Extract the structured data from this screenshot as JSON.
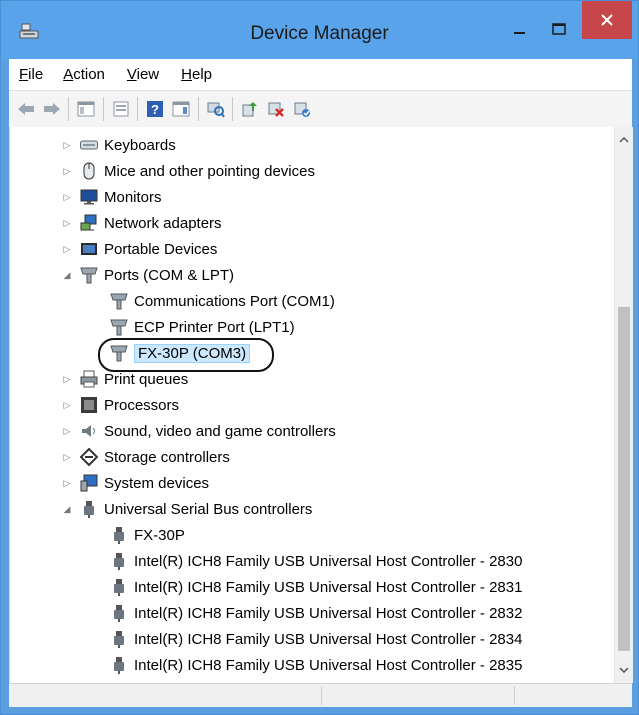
{
  "window": {
    "title": "Device Manager"
  },
  "menu": [
    {
      "prefix": "",
      "underlined": "F",
      "rest": "ile"
    },
    {
      "prefix": "",
      "underlined": "A",
      "rest": "ction"
    },
    {
      "prefix": "",
      "underlined": "V",
      "rest": "iew"
    },
    {
      "prefix": "",
      "underlined": "H",
      "rest": "elp"
    }
  ],
  "tree": {
    "keyboards": "Keyboards",
    "mice": "Mice and other pointing devices",
    "monitors": "Monitors",
    "network": "Network adapters",
    "portable": "Portable Devices",
    "ports": "Ports (COM & LPT)",
    "com1": "Communications Port (COM1)",
    "lpt1": "ECP Printer Port (LPT1)",
    "fx30p_com3": "FX-30P (COM3)",
    "print_queues": "Print queues",
    "processors": "Processors",
    "sound": "Sound, video and game controllers",
    "storage": "Storage controllers",
    "system": "System devices",
    "usb": "Universal Serial Bus controllers",
    "usb_fx30p": "FX-30P",
    "usb_2830": "Intel(R) ICH8 Family USB Universal Host Controller - 2830",
    "usb_2831": "Intel(R) ICH8 Family USB Universal Host Controller - 2831",
    "usb_2832": "Intel(R) ICH8 Family USB Universal Host Controller - 2832",
    "usb_2834": "Intel(R) ICH8 Family USB Universal Host Controller - 2834",
    "usb_2835": "Intel(R) ICH8 Family USB Universal Host Controller - 2835"
  },
  "icons": {
    "toolbar": [
      "back-arrow-icon",
      "forward-arrow-icon",
      "show-hide-console-tree-icon",
      "properties-icon",
      "help-icon",
      "action-pane-icon",
      "scan-hardware-icon",
      "update-driver-icon",
      "uninstall-device-icon",
      "enable-device-icon"
    ]
  },
  "colors": {
    "titlebar": "#59a3ea",
    "close": "#c7464a",
    "selection": "#cce8ff"
  }
}
